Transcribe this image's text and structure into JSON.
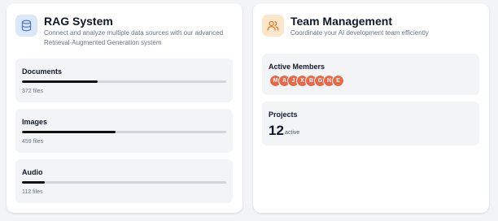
{
  "rag": {
    "title": "RAG System",
    "description": "Connect and analyze multiple data sources with our advanced Retrieval-Augmented Generation system",
    "icon": "database-icon",
    "sources": [
      {
        "label": "Documents",
        "files": "372 files",
        "progress": 0.37
      },
      {
        "label": "Images",
        "files": "459 files",
        "progress": 0.46
      },
      {
        "label": "Audio",
        "files": "112 files",
        "progress": 0.11
      }
    ]
  },
  "team": {
    "title": "Team Management",
    "description": "Coordinate your AI development team efficiently",
    "icon": "users-icon",
    "members_label": "Active Members",
    "members": [
      "M",
      "A",
      "J",
      "X",
      "B",
      "G",
      "N",
      "E"
    ],
    "projects_label": "Projects",
    "projects_count": "12",
    "projects_suffix": "active"
  },
  "colors": {
    "accent_blue_bg": "#dbe7fb",
    "accent_orange_bg": "#fde7cc",
    "avatar": "#e8694a",
    "progress_fill": "#111111",
    "progress_track": "#d1d5db"
  }
}
